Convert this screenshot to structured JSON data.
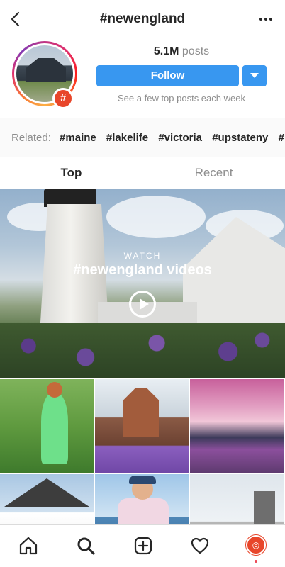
{
  "header": {
    "title": "#newengland",
    "back_icon": "back-arrow-icon",
    "more_icon": "more-options-icon"
  },
  "profile": {
    "posts_count": "5.1M",
    "posts_label": "posts",
    "follow_label": "Follow",
    "hint": "See a few top posts each week",
    "badge": "#",
    "accent_color": "#3897f0"
  },
  "related": {
    "label": "Related:",
    "tags": [
      "#maine",
      "#lakelife",
      "#victoria",
      "#upstateny",
      "#"
    ]
  },
  "tabs": {
    "top": "Top",
    "recent": "Recent"
  },
  "feature": {
    "watch": "WATCH",
    "title": "#newengland videos",
    "play_icon": "play-icon"
  },
  "nav": {
    "home": "home-icon",
    "search": "search-icon",
    "add": "add-post-icon",
    "activity": "heart-icon",
    "profile": "profile-avatar"
  }
}
